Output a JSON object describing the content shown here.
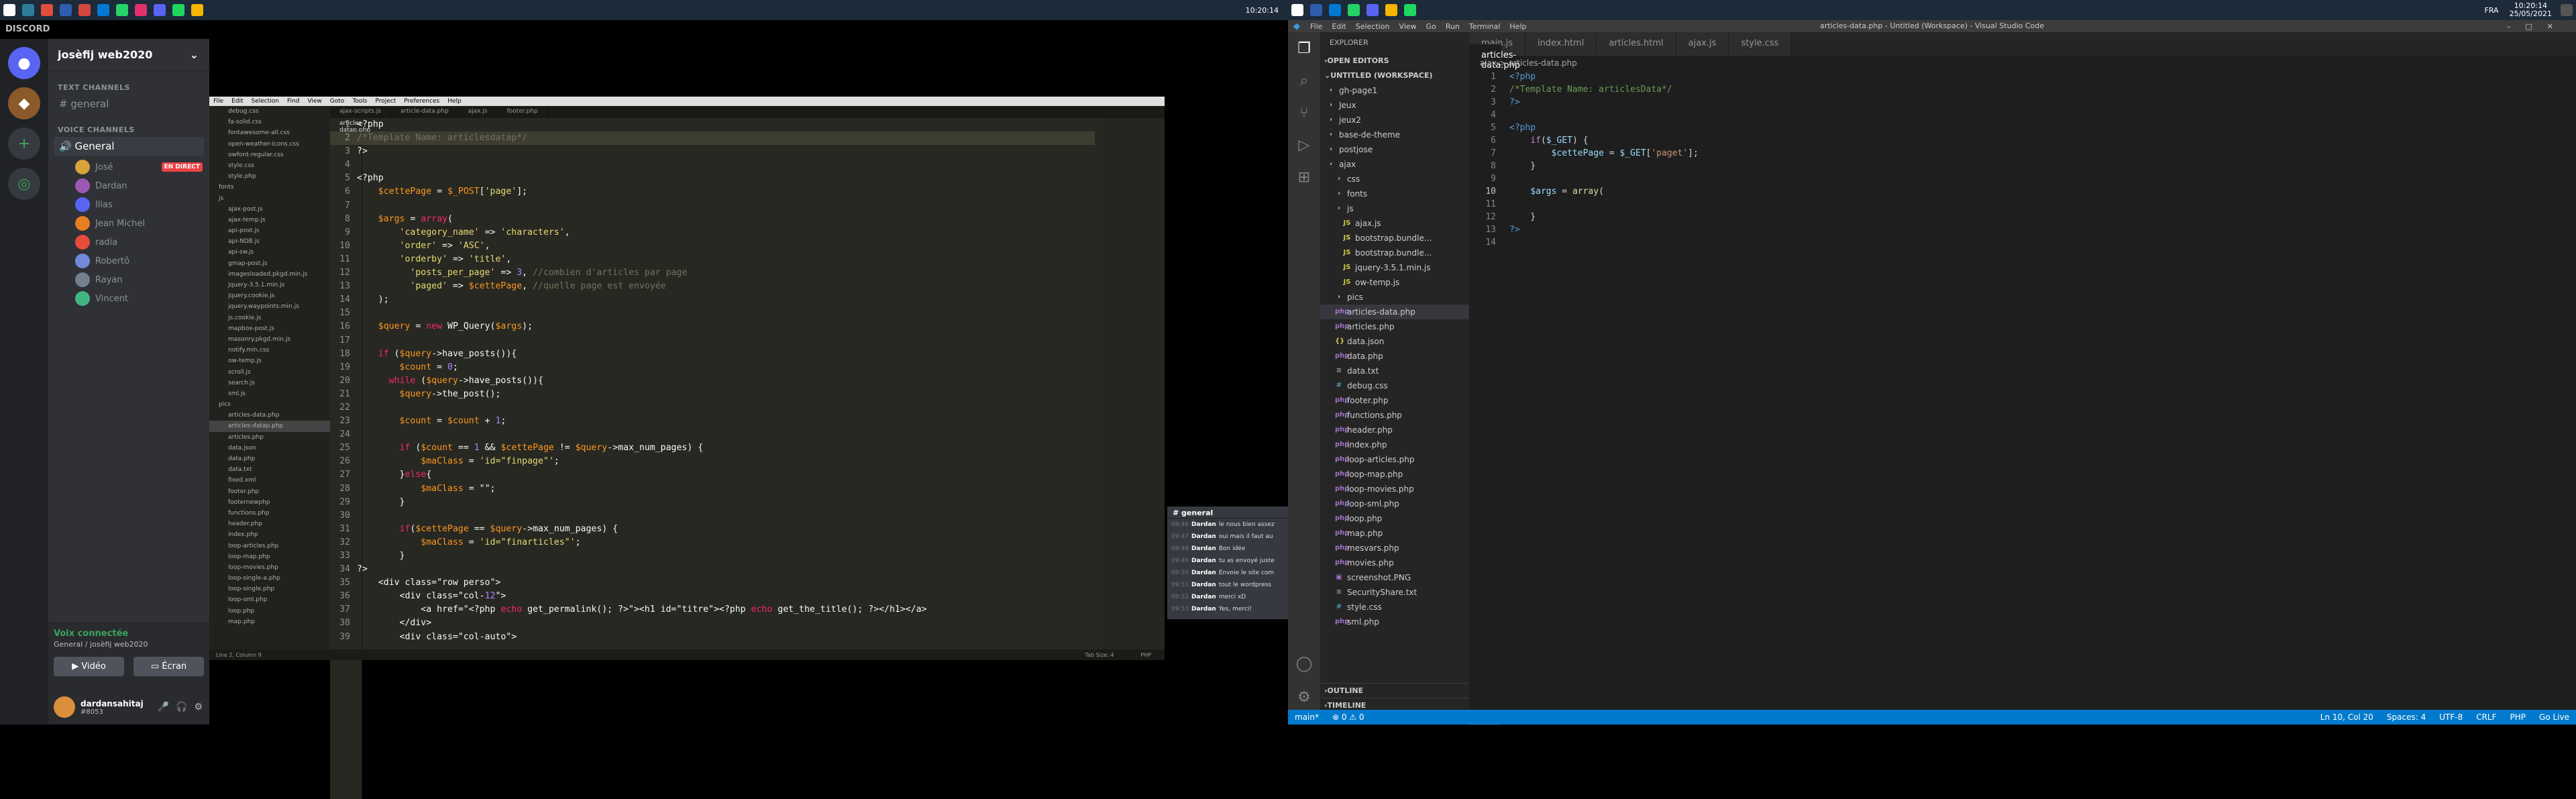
{
  "taskbar_left": {
    "clock": "10:20:14"
  },
  "taskbar_right": {
    "lang": "FRA",
    "clock": "10:20:14",
    "date": "25/05/2021"
  },
  "discord": {
    "app_title": "DISCORD",
    "server_name": "josèfij web2020",
    "text_channels_label": "TEXT CHANNELS",
    "text_channel": "general",
    "voice_channels_label": "VOICE CHANNELS",
    "voice_channel": "General",
    "users": [
      {
        "name": "José",
        "live": "EN DIRECT",
        "color": "#d9a23b"
      },
      {
        "name": "Dardan",
        "color": "#9b59b6"
      },
      {
        "name": "Ilias",
        "color": "#5865f2"
      },
      {
        "name": "Jean Michel",
        "color": "#e67e22"
      },
      {
        "name": "radia",
        "color": "#e74c3c"
      },
      {
        "name": "Robertô",
        "color": "#7289da"
      },
      {
        "name": "Rayan",
        "color": "#747f8d"
      },
      {
        "name": "Vincent",
        "color": "#43b581"
      }
    ],
    "voice_connected": "Voix connectée",
    "voice_location": "General / josèfij web2020",
    "video_btn": "Vidéo",
    "screen_btn": "Écran",
    "username": "dardansahitaj",
    "tag": "#8053"
  },
  "sublime": {
    "menu": [
      "File",
      "Edit",
      "Selection",
      "Find",
      "View",
      "Goto",
      "Tools",
      "Project",
      "Preferences",
      "Help"
    ],
    "tabs": [
      "ajax-scripts.js",
      "article-data.php",
      "articles-datap.php",
      "ajax.js",
      "footer.php"
    ],
    "tree": [
      "debug.css",
      "fa-solid.css",
      "fontawesome-all.css",
      "open-weather-icons.css",
      "owfont-regular.css",
      "style.css",
      "style.php",
      "fonts",
      "js",
      "ajax-post.js",
      "ajax-temp.js",
      "api-post.js",
      "api-NDB.js",
      "api-sw.js",
      "gmap-post.js",
      "imagesloaded.pkgd.min.js",
      "jquery-3.5.1.min.js",
      "jquery.cookie.js",
      "jquery.waypoints.min.js",
      "js.cookie.js",
      "mapbox-post.js",
      "masonry.pkgd.min.js",
      "notify.min.css",
      "ow-temp.js",
      "scroll.js",
      "search.js",
      "sml.js",
      "pics",
      "articles-data.php",
      "articles-datap.php",
      "articles.php",
      "data.json",
      "data.php",
      "data.txt",
      "fixed.xml",
      "footer.php",
      "footernewphp",
      "functions.php",
      "header.php",
      "index.php",
      "loop-articles.php",
      "loop-map.php",
      "loop-movies.php",
      "loop-single-a.php",
      "loop-single.php",
      "loop-sml.php",
      "loop.php",
      "map.php"
    ],
    "code": [
      "<?php",
      "/*Template Name: articlesdatap*/",
      "?>",
      "",
      "<?php",
      "    $cettePage = $_POST['page'];",
      "",
      "    $args = array(",
      "        'category_name' => 'characters',",
      "        'order' => 'ASC',",
      "        'orderby' => 'title',",
      "          'posts_per_page' => 3, //combien d'articles par page",
      "          'paged' => $cettePage, //quelle page est envoyée",
      "    );",
      "",
      "    $query = new WP_Query($args);",
      "",
      "    if ($query->have_posts()){",
      "        $count = 0;",
      "      while ($query->have_posts()){",
      "        $query->the_post();",
      "",
      "        $count = $count + 1;",
      "",
      "        if ($count == 1 && $cettePage != $query->max_num_pages) {",
      "            $maClass = 'id=\"finpage\"';",
      "        }else{",
      "            $maClass = \"\";",
      "        }",
      "",
      "        if($cettePage == $query->max_num_pages) {",
      "            $maClass = 'id=\"finarticles\"';",
      "        }",
      "?>",
      "    <div class=\"row perso\">",
      "        <div class=\"col-12\">",
      "            <a href=\"<?php echo get_permalink(); ?>\"><h1 id=\"titre\"><?php echo get_the_title(); ?></h1></a>",
      "        </div>",
      "        <div class=\"col-auto\">"
    ],
    "status_left": "Line 2, Column 9",
    "status_right": "Tab Size: 4",
    "status_lang": "PHP"
  },
  "mini_chat": {
    "title": "general",
    "messages": [
      {
        "time": "09:46",
        "user": "Dardan",
        "text": "le nous bien assez"
      },
      {
        "time": "09:47",
        "user": "Dardan",
        "text": "oui mais il faut au"
      },
      {
        "time": "09:48",
        "user": "Dardan",
        "text": "Bon idée"
      },
      {
        "time": "09:49",
        "user": "Dardan",
        "text": "tu as envoyé juste"
      },
      {
        "time": "09:50",
        "user": "Dardan",
        "text": "Envoie le site com"
      },
      {
        "time": "09:51",
        "user": "Dardan",
        "text": "tout le wordpress"
      },
      {
        "time": "09:52",
        "user": "Dardan",
        "text": "merci xD"
      },
      {
        "time": "09:53",
        "user": "Dardan",
        "text": "Yes, merci!"
      }
    ]
  },
  "vscode": {
    "menu": [
      "File",
      "Edit",
      "Selection",
      "View",
      "Go",
      "Run",
      "Terminal",
      "Help"
    ],
    "window_title": "articles-data.php - Untitled (Workspace) - Visual Studio Code",
    "explorer_label": "EXPLORER",
    "open_editors": "OPEN EDITORS",
    "workspace": "UNTITLED (WORKSPACE)",
    "tabs": [
      "main.js",
      "index.html",
      "articles.html",
      "articles-data.php",
      "ajax.js",
      "style.css"
    ],
    "active_tab": "articles-data.php",
    "breadcrumb": "ajax > articles-data.php",
    "files": [
      {
        "name": "gh-page1",
        "type": "folder",
        "depth": 0
      },
      {
        "name": "Jeux",
        "type": "folder",
        "depth": 0
      },
      {
        "name": "jeux2",
        "type": "folder",
        "depth": 0
      },
      {
        "name": "base-de-theme",
        "type": "folder",
        "depth": 0
      },
      {
        "name": "postjose",
        "type": "folder",
        "depth": 0
      },
      {
        "name": "ajax",
        "type": "folder",
        "depth": 0
      },
      {
        "name": "css",
        "type": "folder",
        "depth": 1
      },
      {
        "name": "fonts",
        "type": "folder",
        "depth": 1
      },
      {
        "name": "js",
        "type": "folder",
        "depth": 1
      },
      {
        "name": "ajax.js",
        "type": "js",
        "depth": 2
      },
      {
        "name": "bootstrap.bundle...",
        "type": "js",
        "depth": 2
      },
      {
        "name": "bootstrap.bundle...",
        "type": "js",
        "depth": 2
      },
      {
        "name": "jquery-3.5.1.min.js",
        "type": "js",
        "depth": 2
      },
      {
        "name": "ow-temp.js",
        "type": "js",
        "depth": 2
      },
      {
        "name": "pics",
        "type": "folder",
        "depth": 1
      },
      {
        "name": "articles-data.php",
        "type": "php",
        "depth": 1
      },
      {
        "name": "articles.php",
        "type": "php",
        "depth": 1
      },
      {
        "name": "data.json",
        "type": "json",
        "depth": 1
      },
      {
        "name": "data.php",
        "type": "php",
        "depth": 1
      },
      {
        "name": "data.txt",
        "type": "txt",
        "depth": 1
      },
      {
        "name": "debug.css",
        "type": "css",
        "depth": 1
      },
      {
        "name": "footer.php",
        "type": "php",
        "depth": 1
      },
      {
        "name": "functions.php",
        "type": "php",
        "depth": 1
      },
      {
        "name": "header.php",
        "type": "php",
        "depth": 1
      },
      {
        "name": "index.php",
        "type": "php",
        "depth": 1
      },
      {
        "name": "loop-articles.php",
        "type": "php",
        "depth": 1
      },
      {
        "name": "loop-map.php",
        "type": "php",
        "depth": 1
      },
      {
        "name": "loop-movies.php",
        "type": "php",
        "depth": 1
      },
      {
        "name": "loop-sml.php",
        "type": "php",
        "depth": 1
      },
      {
        "name": "loop.php",
        "type": "php",
        "depth": 1
      },
      {
        "name": "map.php",
        "type": "php",
        "depth": 1
      },
      {
        "name": "mesvars.php",
        "type": "php",
        "depth": 1
      },
      {
        "name": "movies.php",
        "type": "php",
        "depth": 1
      },
      {
        "name": "screenshot.PNG",
        "type": "img",
        "depth": 1
      },
      {
        "name": "SecurityShare.txt",
        "type": "txt",
        "depth": 1
      },
      {
        "name": "style.css",
        "type": "css",
        "depth": 1
      },
      {
        "name": "sml.php",
        "type": "php",
        "depth": 1
      }
    ],
    "outline": "OUTLINE",
    "timeline": "TIMELINE",
    "code": [
      "<?php",
      "/*Template Name: articlesData*/",
      "?>",
      "",
      "<?php",
      "    if($_GET) {",
      "        $cettePage = $_GET['paget'];",
      "    }",
      "",
      "    $args = array(",
      "",
      "    }",
      "?>",
      ""
    ],
    "status": {
      "branch": "main*",
      "errors": "⊗ 0 ⚠ 0",
      "pos": "Ln 10, Col 20",
      "spaces": "Spaces: 4",
      "enc": "UTF-8",
      "eol": "CRLF",
      "lang": "PHP",
      "golive": "Go Live"
    }
  }
}
